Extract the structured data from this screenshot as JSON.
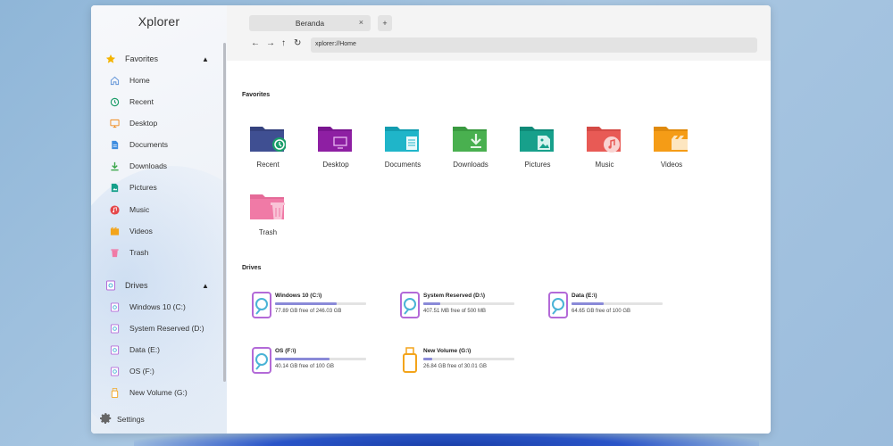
{
  "app": {
    "title": "Xplorer"
  },
  "tabs": [
    {
      "label": "Beranda"
    }
  ],
  "toolbar": {
    "new_tab": "+",
    "back": "←",
    "forward": "→",
    "up": "↑",
    "refresh": "↻",
    "close_tab": "×"
  },
  "address": {
    "value": "xplorer://Home"
  },
  "window_controls": {
    "minimize_color": "#f5c518",
    "maximize_color": "#28c840",
    "close_color": "#ec4848"
  },
  "sidebar": {
    "favorites_label": "Favorites",
    "favorites": [
      {
        "label": "Home",
        "icon": "home-icon"
      },
      {
        "label": "Recent",
        "icon": "recent-icon"
      },
      {
        "label": "Desktop",
        "icon": "desktop-icon"
      },
      {
        "label": "Documents",
        "icon": "documents-icon"
      },
      {
        "label": "Downloads",
        "icon": "downloads-icon"
      },
      {
        "label": "Pictures",
        "icon": "pictures-icon"
      },
      {
        "label": "Music",
        "icon": "music-icon"
      },
      {
        "label": "Videos",
        "icon": "videos-icon"
      },
      {
        "label": "Trash",
        "icon": "trash-icon"
      }
    ],
    "drives_label": "Drives",
    "drives": [
      {
        "label": "Windows 10 (C:)"
      },
      {
        "label": "System Reserved (D:)"
      },
      {
        "label": "Data (E:)"
      },
      {
        "label": "OS (F:)"
      },
      {
        "label": "New Volume (G:)"
      }
    ],
    "settings_label": "Settings"
  },
  "main": {
    "favorites_title": "Favorites",
    "folders": [
      {
        "label": "Recent",
        "color": "#3a4c8c"
      },
      {
        "label": "Desktop",
        "color": "#8e1fa3"
      },
      {
        "label": "Documents",
        "color": "#1fb5c9"
      },
      {
        "label": "Downloads",
        "color": "#49b04f"
      },
      {
        "label": "Pictures",
        "color": "#17a08b"
      },
      {
        "label": "Music",
        "color": "#e85a55"
      },
      {
        "label": "Videos",
        "color": "#f59c16"
      },
      {
        "label": "Trash",
        "color": "#f07aa6"
      }
    ],
    "drives_title": "Drives",
    "drives": [
      {
        "name": "Windows 10 (C:\\)",
        "free": "77.89 GB free of 246.03 GB",
        "used_fraction": 0.68
      },
      {
        "name": "System Reserved (D:\\)",
        "free": "407.51 MB free of 500 MB",
        "used_fraction": 0.19
      },
      {
        "name": "Data (E:\\)",
        "free": "64.65 GB free of 100 GB",
        "used_fraction": 0.35
      },
      {
        "name": "OS (F:\\)",
        "free": "40.14 GB free of 100 GB",
        "used_fraction": 0.6
      },
      {
        "name": "New Volume (G:\\)",
        "free": "26.84 GB free of 30.01 GB",
        "used_fraction": 0.1
      }
    ]
  }
}
